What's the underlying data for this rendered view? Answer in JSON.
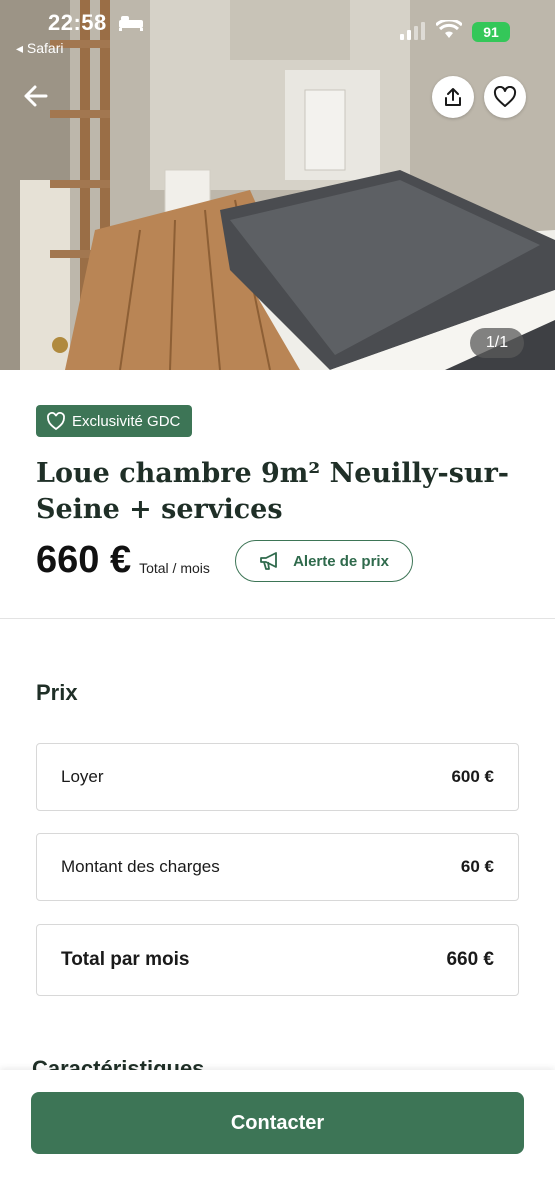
{
  "status_bar": {
    "time": "22:58",
    "back_app": "◂ Safari",
    "battery": "91"
  },
  "gallery": {
    "counter": "1/1"
  },
  "listing": {
    "badge": "Exclusivité GDC",
    "title": "Loue chambre 9m² Neuilly-sur-Seine + services",
    "price": "660 €",
    "price_unit": "Total / mois",
    "alert_button": "Alerte de prix"
  },
  "prix": {
    "section_title": "Prix",
    "rows": [
      {
        "label": "Loyer",
        "value": "600 €"
      },
      {
        "label": "Montant des charges",
        "value": "60 €"
      },
      {
        "label": "Total par mois",
        "value": "660 €"
      }
    ]
  },
  "next_section_title": "Caractéristiques",
  "cta": {
    "contact": "Contacter"
  },
  "colors": {
    "brand_green": "#3d7556",
    "battery_green": "#34c759"
  },
  "icons": [
    "bed-icon",
    "signal-icon",
    "wifi-icon",
    "back-arrow-icon",
    "share-icon",
    "heart-icon",
    "badge-heart-icon",
    "megaphone-icon"
  ]
}
